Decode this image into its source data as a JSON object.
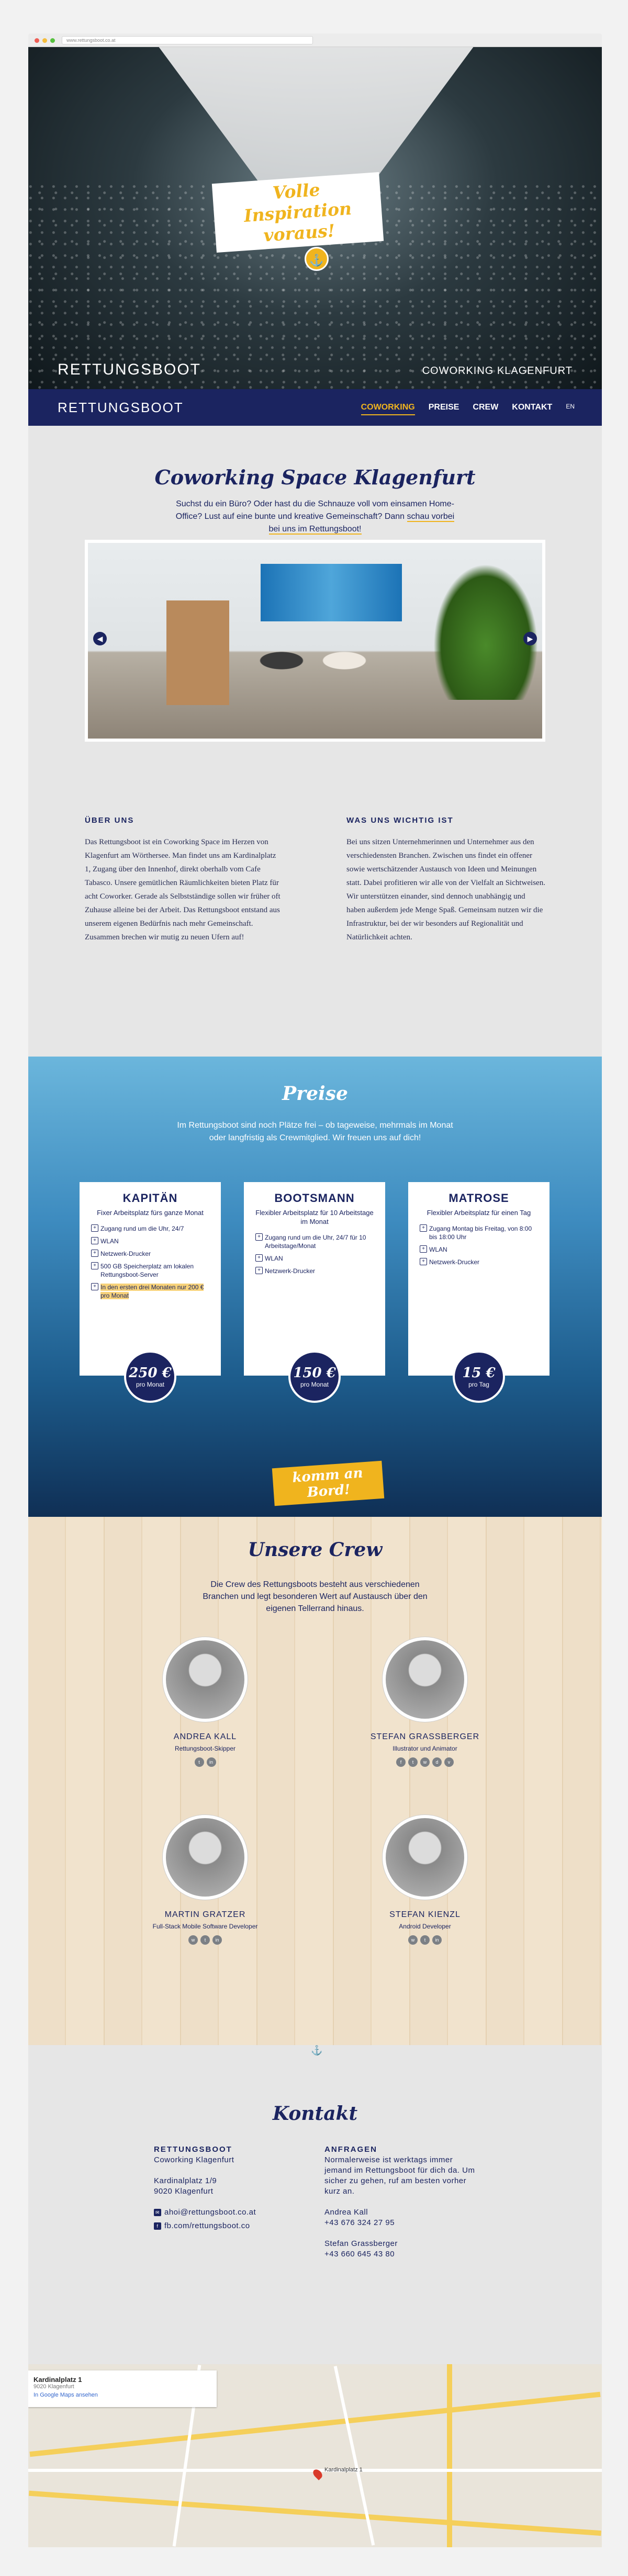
{
  "browser": {
    "url": "www.rettungsboot.co.at"
  },
  "hero": {
    "tagline": "Volle Inspiration voraus!",
    "logo": "RETTUNGSBOOT",
    "subtitle": "COWORKING KLAGENFURT"
  },
  "nav": {
    "logo": "RETTUNGSBOOT",
    "items": [
      "COWORKING",
      "PREISE",
      "CREW",
      "KONTAKT"
    ],
    "lang": "EN"
  },
  "coworking": {
    "title": "Coworking Space Klagenfurt",
    "intro": "Suchst du ein Büro? Oder hast du die Schnauze voll vom einsamen Home-Office? Lust auf eine bunte und kreative Gemeinschaft? Dann",
    "intro_link": "schau vorbei bei uns im Rettungsboot!",
    "about_title": "ÜBER UNS",
    "about_text": "Das Rettungsboot ist ein Coworking Space im Herzen von Klagenfurt am Wörthersee. Man findet uns am Kardinalplatz 1, Zugang über den Innenhof, direkt oberhalb vom Cafe Tabasco. Unsere gemütlichen Räumlichkeiten bieten Platz für acht Coworker. Gerade als Selbstständige sollen wir früher oft Zuhause alleine bei der Arbeit. Das Rettungsboot entstand aus unserem eigenen Bedürfnis nach mehr Gemeinschaft. Zusammen brechen wir mutig zu neuen Ufern auf!",
    "values_title": "WAS UNS WICHTIG IST",
    "values_text": "Bei uns sitzen Unternehmerinnen und Unternehmer aus den verschiedensten Branchen. Zwischen uns findet ein offener sowie wertschätzender Austausch von Ideen und Meinungen statt. Dabei profitieren wir alle von der Vielfalt an Sichtweisen. Wir unterstützen einander, sind dennoch unabhängig und haben außerdem jede Menge Spaß. Gemeinsam nutzen wir die Infrastruktur, bei der wir besonders auf Regionalität und Natürlichkeit achten."
  },
  "prices": {
    "title": "Preise",
    "intro": "Im Rettungsboot sind noch Plätze frei – ob tageweise, mehrmals im Monat oder langfristig als Crewmitglied. Wir freuen uns auf dich!",
    "plans": [
      {
        "name": "KAPITÄN",
        "desc": "Fixer Arbeitsplatz fürs ganze Monat",
        "features": [
          "Zugang rund um die Uhr, 24/7",
          "WLAN",
          "Netzwerk-Drucker",
          "500 GB Speicherplatz am lokalen Rettungsboot-Server"
        ],
        "highlight": "In den ersten drei Monaten nur 200 € pro Monat",
        "price": "250 €",
        "unit": "pro Monat"
      },
      {
        "name": "BOOTSMANN",
        "desc": "Flexibler Arbeitsplatz für 10 Arbeitstage im Monat",
        "features": [
          "Zugang rund um die Uhr, 24/7 für 10 Arbeitstage/Monat",
          "WLAN",
          "Netzwerk-Drucker"
        ],
        "highlight": "",
        "price": "150 €",
        "unit": "pro Monat"
      },
      {
        "name": "MATROSE",
        "desc": "Flexibler Arbeitsplatz für einen Tag",
        "features": [
          "Zugang Montag bis Freitag, von 8:00 bis 18:00 Uhr",
          "WLAN",
          "Netzwerk-Drucker"
        ],
        "highlight": "",
        "price": "15 €",
        "unit": "pro Tag"
      }
    ],
    "cta": "komm an Bord!"
  },
  "crew": {
    "title": "Unsere Crew",
    "intro": "Die Crew des Rettungsboots besteht aus verschiedenen Branchen und legt besonderen Wert auf Austausch über den eigenen Tellerrand hinaus.",
    "members": [
      {
        "name": "ANDREA KALL",
        "role": "Rettungsboot-Skipper"
      },
      {
        "name": "STEFAN GRASSBERGER",
        "role": "Illustrator und Animator"
      },
      {
        "name": "MARTIN GRATZER",
        "role": "Full-Stack Mobile Software Developer"
      },
      {
        "name": "STEFAN KIENZL",
        "role": "Android Developer"
      }
    ]
  },
  "contact": {
    "title": "Kontakt",
    "org": "RETTUNGSBOOT",
    "org_sub": "Coworking Klagenfurt",
    "street": "Kardinalplatz 1/9",
    "city": "9020 Klagenfurt",
    "email": "ahoi@rettungsboot.co.at",
    "fb": "fb.com/rettungsboot.co",
    "req_title": "ANFRAGEN",
    "req_text": "Normalerweise ist werktags immer jemand im Rettungsboot für dich da. Um sicher zu gehen, ruf am besten vorher kurz an.",
    "p1_name": "Andrea Kall",
    "p1_phone": "+43 676 324 27 95",
    "p2_name": "Stefan Grassberger",
    "p2_phone": "+43 660 645 43 80"
  },
  "map": {
    "place": "Kardinalplatz 1",
    "address": "9020 Klagenfurt",
    "link": "In Google Maps ansehen",
    "pin": "Kardinalplatz 1"
  }
}
